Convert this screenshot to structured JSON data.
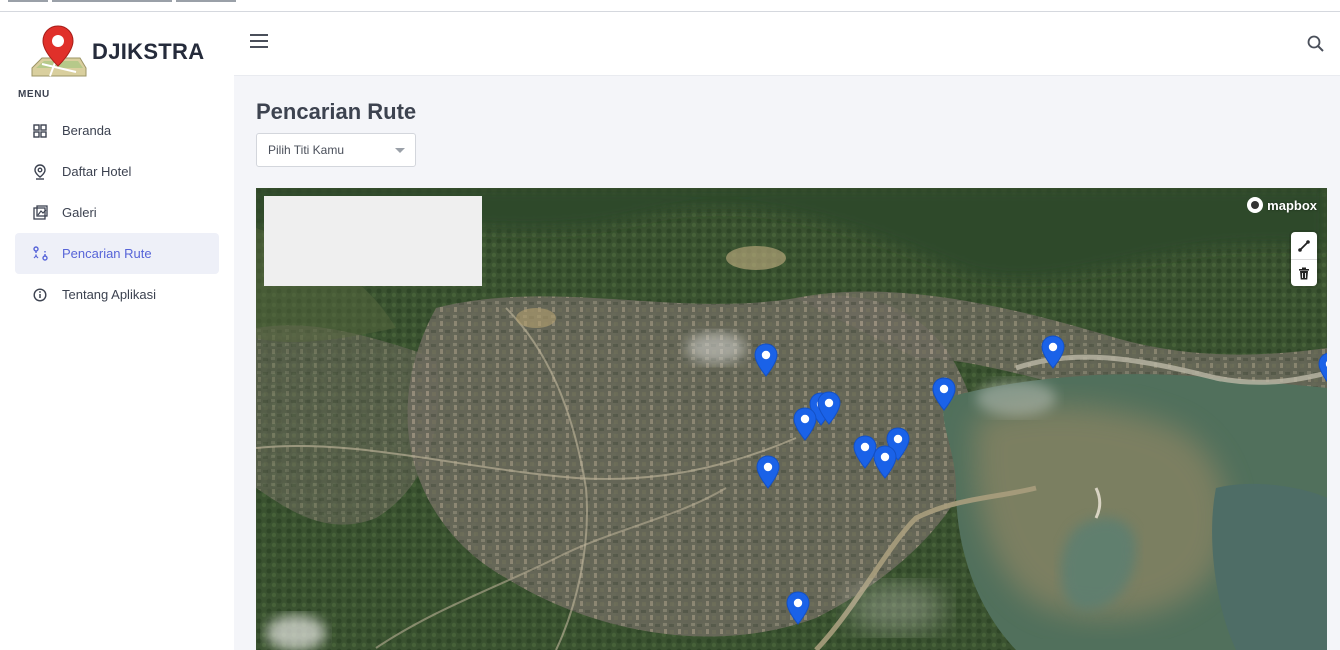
{
  "brand": {
    "name": "DJIKSTRA",
    "logo_icon": "map-pin-logo"
  },
  "sidebar": {
    "menu_title": "MENU",
    "items": [
      {
        "label": "Beranda",
        "icon": "grid-icon",
        "active": false
      },
      {
        "label": "Daftar Hotel",
        "icon": "location-pin-icon",
        "active": false
      },
      {
        "label": "Galeri",
        "icon": "gallery-icon",
        "active": false
      },
      {
        "label": "Pencarian Rute",
        "icon": "route-icon",
        "active": true
      },
      {
        "label": "Tentang Aplikasi",
        "icon": "info-icon",
        "active": false
      }
    ]
  },
  "topbar": {
    "menu_icon": "hamburger-icon",
    "search_icon": "search-icon"
  },
  "main": {
    "title": "Pencarian Rute",
    "select": {
      "value": "Pilih Titi Kamu"
    }
  },
  "map": {
    "attribution": "mapbox",
    "controls": [
      {
        "icon": "draw-line-icon"
      },
      {
        "icon": "trash-icon"
      }
    ],
    "marker_count": 13,
    "marker_color": "#1a62e8"
  },
  "colors": {
    "accent": "#5764d8",
    "active_bg": "#eef0f8",
    "page_bg": "#f4f5f9",
    "logo_pin": "#e0302a"
  }
}
